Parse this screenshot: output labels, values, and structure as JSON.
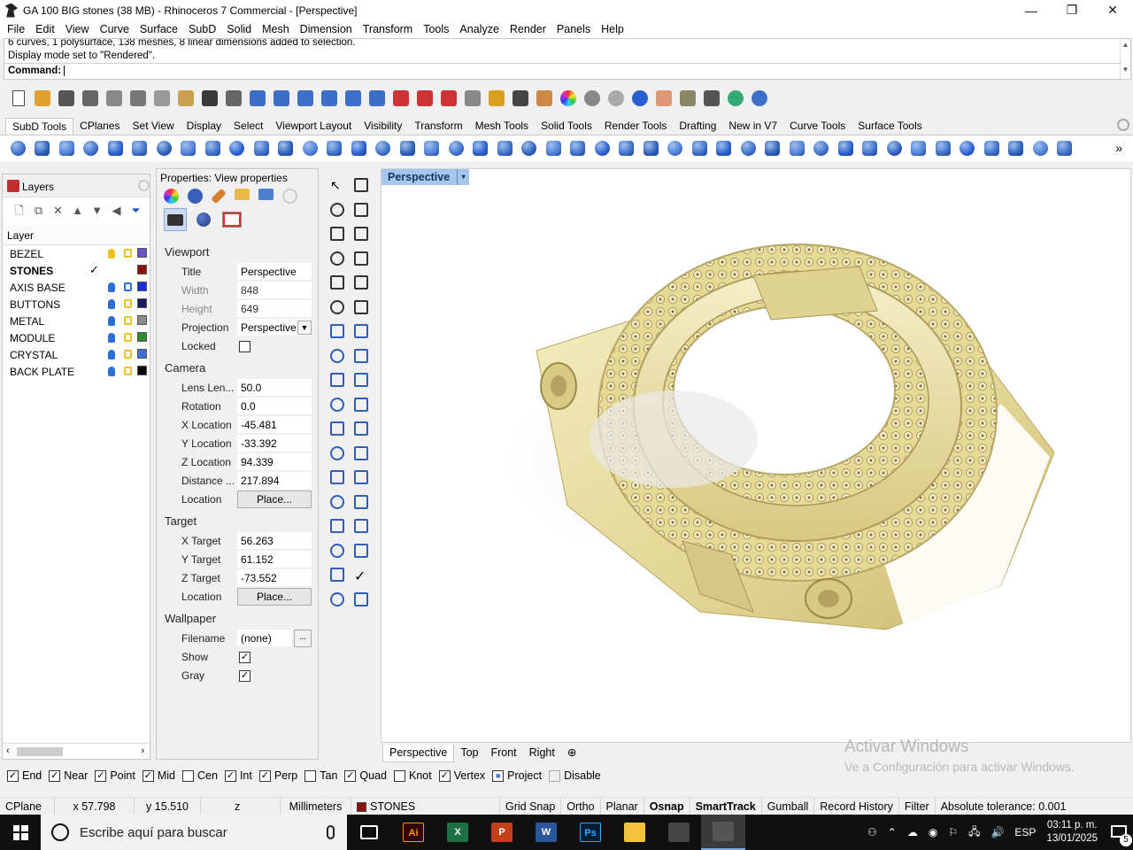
{
  "titlebar": {
    "title": "GA 100 BIG stones (38 MB) - Rhinoceros 7 Commercial - [Perspective]",
    "minimize": "—",
    "maximize": "❐",
    "close": "✕"
  },
  "menu": [
    "File",
    "Edit",
    "View",
    "Curve",
    "Surface",
    "SubD",
    "Solid",
    "Mesh",
    "Dimension",
    "Transform",
    "Tools",
    "Analyze",
    "Render",
    "Panels",
    "Help"
  ],
  "command": {
    "history_1": "6 curves, 1 polysurface, 138 meshes, 8 linear dimensions added to selection.",
    "history_2": "Display mode set to \"Rendered\".",
    "prompt": "Command:",
    "value": ""
  },
  "toolbar_tabs": [
    "SubD Tools",
    "CPlanes",
    "Set View",
    "Display",
    "Select",
    "Viewport Layout",
    "Visibility",
    "Transform",
    "Mesh Tools",
    "Solid Tools",
    "Render Tools",
    "Drafting",
    "New in V7",
    "Curve Tools",
    "Surface Tools"
  ],
  "active_toolbar_tab": "SubD Tools",
  "std_icons": [
    "new-file",
    "open-file",
    "save",
    "print",
    "import",
    "cut",
    "copy",
    "paste",
    "undo",
    "pan",
    "rotate-view",
    "zoom",
    "zoom-window",
    "zoom-extents",
    "zoom-selected",
    "zoom-all",
    "car-named-view",
    "car-2",
    "car-3",
    "cplane",
    "light",
    "lock",
    "layers-book",
    "color-wheel",
    "render-sphere-gray",
    "render-sphere-silver",
    "render-sphere-blue",
    "snap-point",
    "options-gear",
    "dims",
    "rhino-render",
    "help"
  ],
  "subd_icons": [
    "subd-box",
    "subd-cube",
    "subd-cone",
    "subd-pyramid",
    "subd-cylinder",
    "subd-sphere",
    "subd-ellipsoid",
    "subd-torus",
    "subd-pipe",
    "subd-multipipe",
    "subd-loft",
    "subd-split",
    "subd-sweep",
    "subd-tube",
    "subd-crease",
    "subd-fill",
    "subd-bridge",
    "subd-extrude",
    "subd-bevel",
    "subd-offset",
    "subd-slide",
    "subd-insert",
    "subd-mesh",
    "subd-grid",
    "subd-frame",
    "subd-cup",
    "subd-align",
    "subd-symmetry",
    "subd-delete",
    "subd-remove",
    "subd-patch",
    "subd-face",
    "subd-edge",
    "subd-clip",
    "subd-lattice",
    "subd-curve",
    "subd-tools",
    "subd-repair",
    "subd-vertex",
    "subd-smooth",
    "subd-globe",
    "subd-select",
    "subd-brush",
    "subd-end"
  ],
  "layers_panel": {
    "tab_label": "Layers",
    "column_header": "Layer",
    "layers": [
      {
        "name": "BEZEL",
        "current": false,
        "visible_color": "yellow",
        "locked_color": "yellow",
        "color": "#6a4fc8"
      },
      {
        "name": "STONES",
        "current": true,
        "check": "✓",
        "color": "#8b1010"
      },
      {
        "name": "AXIS BASE",
        "current": false,
        "visible_color": "blue",
        "locked_color": "blue",
        "color": "#1a2fd6"
      },
      {
        "name": "BUTTONS",
        "current": false,
        "visible_color": "blue",
        "locked_color": "yellow",
        "color": "#1c1c5a"
      },
      {
        "name": "METAL",
        "current": false,
        "visible_color": "blue",
        "locked_color": "yellow",
        "color": "#8a8a8a"
      },
      {
        "name": "MODULE",
        "current": false,
        "visible_color": "blue",
        "locked_color": "yellow",
        "color": "#2d8a2d"
      },
      {
        "name": "CRYSTAL",
        "current": false,
        "visible_color": "blue",
        "locked_color": "yellow",
        "color": "#3f6fd6"
      },
      {
        "name": "BACK PLATE",
        "current": false,
        "visible_color": "blue",
        "locked_color": "yellow",
        "color": "#0a0a0a"
      }
    ]
  },
  "properties_panel": {
    "header": "Properties: View properties",
    "viewport_section": "Viewport",
    "title_label": "Title",
    "title_value": "Perspective",
    "width_label": "Width",
    "width_value": "848",
    "height_label": "Height",
    "height_value": "649",
    "projection_label": "Projection",
    "projection_value": "Perspective",
    "locked_label": "Locked",
    "locked_checked": "",
    "camera_section": "Camera",
    "lens_label": "Lens Len...",
    "lens_value": "50.0",
    "rotation_label": "Rotation",
    "rotation_value": "0.0",
    "xloc_label": "X Location",
    "xloc_value": "-45.481",
    "yloc_label": "Y Location",
    "yloc_value": "-33.392",
    "zloc_label": "Z Location",
    "zloc_value": "94.339",
    "distance_label": "Distance ...",
    "distance_value": "217.894",
    "location_label": "Location",
    "place_button": "Place...",
    "target_section": "Target",
    "xtarget_label": "X Target",
    "xtarget_value": "56.263",
    "ytarget_label": "Y Target",
    "ytarget_value": "61.152",
    "ztarget_label": "Z Target",
    "ztarget_value": "-73.552",
    "target_location_label": "Location",
    "target_place_button": "Place...",
    "wallpaper_section": "Wallpaper",
    "filename_label": "Filename",
    "filename_value": "(none)",
    "browse_button": "...",
    "show_label": "Show",
    "show_checked": "✓",
    "gray_label": "Gray",
    "gray_checked": "✓"
  },
  "viewport": {
    "title": "Perspective",
    "dropdown": "▾",
    "tabs": [
      "Perspective",
      "Top",
      "Front",
      "Right"
    ],
    "add_tab": "⊕",
    "object_color": "#efe6ad"
  },
  "activation": {
    "line1": "Activar Windows",
    "line2": "Ve a Configuración para activar Windows."
  },
  "osnaps": [
    {
      "label": "End",
      "checked": "✓"
    },
    {
      "label": "Near",
      "checked": "✓"
    },
    {
      "label": "Point",
      "checked": "✓"
    },
    {
      "label": "Mid",
      "checked": "✓"
    },
    {
      "label": "Cen",
      "checked": ""
    },
    {
      "label": "Int",
      "checked": "✓"
    },
    {
      "label": "Perp",
      "checked": "✓"
    },
    {
      "label": "Tan",
      "checked": ""
    },
    {
      "label": "Quad",
      "checked": "✓"
    },
    {
      "label": "Knot",
      "checked": ""
    },
    {
      "label": "Vertex",
      "checked": "✓"
    },
    {
      "label": "Project",
      "checked": "■"
    },
    {
      "label": "Disable",
      "checked": ""
    }
  ],
  "statusbar": {
    "cplane": "CPlane",
    "x": "x 57.798",
    "y": "y 15.510",
    "z": "z",
    "units": "Millimeters",
    "layer": "STONES",
    "grid_snap": "Grid Snap",
    "ortho": "Ortho",
    "planar": "Planar",
    "osnap": "Osnap",
    "smarttrack": "SmartTrack",
    "gumball": "Gumball",
    "record_history": "Record History",
    "filter": "Filter",
    "tolerance": "Absolute tolerance: 0.001"
  },
  "taskbar": {
    "search_placeholder": "Escribe aquí para buscar",
    "apps": [
      {
        "name": "task-view",
        "label": "",
        "color": "#101010"
      },
      {
        "name": "illustrator",
        "label": "Ai",
        "color": "#330000"
      },
      {
        "name": "excel",
        "label": "X",
        "color": "#1d7044"
      },
      {
        "name": "powerpoint",
        "label": "P",
        "color": "#c43e1c"
      },
      {
        "name": "word",
        "label": "W",
        "color": "#2b579a"
      },
      {
        "name": "photoshop",
        "label": "Ps",
        "color": "#001e36"
      },
      {
        "name": "file-explorer",
        "label": "",
        "color": "#f3c13a"
      },
      {
        "name": "calculator",
        "label": "",
        "color": "#444"
      },
      {
        "name": "rhino",
        "label": "",
        "color": "#555"
      }
    ],
    "language": "ESP",
    "time": "03:11 p. m.",
    "date": "13/01/2025",
    "notifications": "5"
  }
}
